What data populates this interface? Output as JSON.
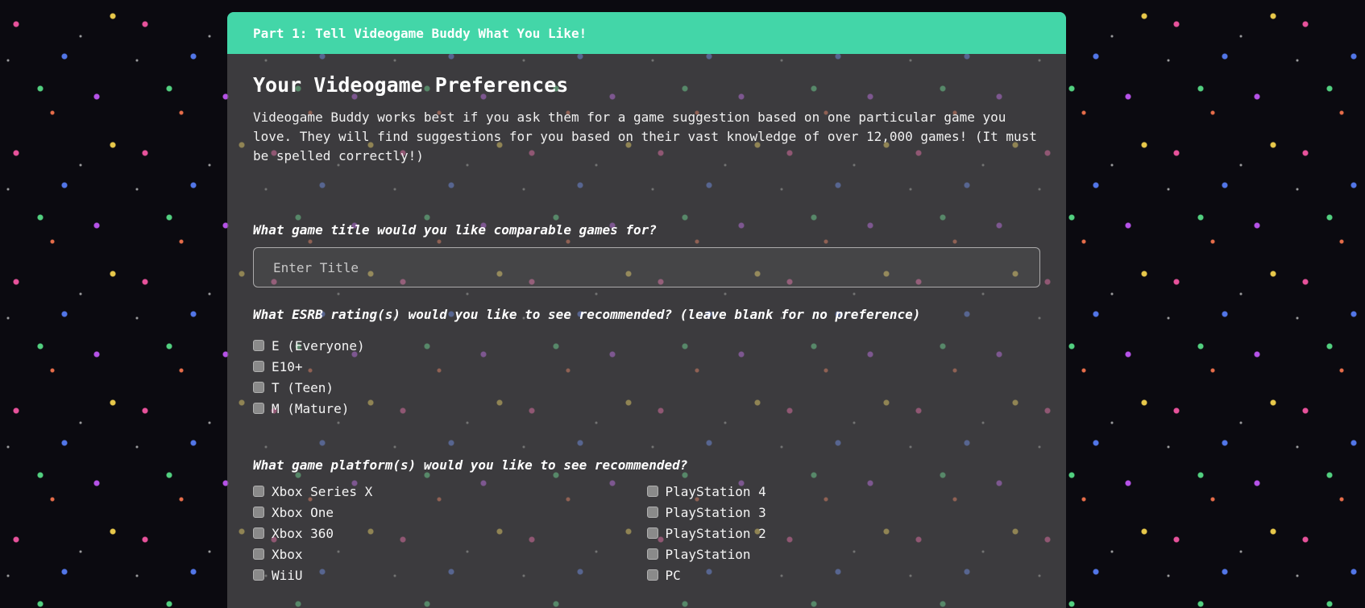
{
  "header": {
    "title": "Part 1: Tell Videogame Buddy What You Like!"
  },
  "preferences": {
    "heading": "Your Videogame Preferences",
    "intro": "Videogame Buddy works best if you ask them for a game suggestion based on one particular game you love. They will find suggestions for you based on their vast knowledge of over 12,000 games! (It must be spelled correctly!)"
  },
  "title_question": {
    "label": "What game title would you like comparable games for?",
    "placeholder": "Enter Title",
    "value": ""
  },
  "esrb": {
    "label": "What ESRB rating(s) would you like to see recommended? (leave blank for no preference)",
    "options": [
      "E (Everyone)",
      "E10+",
      "T (Teen)",
      "M (Mature)"
    ]
  },
  "platforms": {
    "label": "What game platform(s) would you like to see recommended?",
    "left": [
      "Xbox Series X",
      "Xbox One",
      "Xbox 360",
      "Xbox",
      "WiiU"
    ],
    "right": [
      "PlayStation 4",
      "PlayStation 3",
      "PlayStation 2",
      "PlayStation",
      "PC"
    ]
  },
  "colors": {
    "header_bg": "#43d6a8",
    "card_bg": "rgba(90,90,90,0.62)",
    "page_bg": "#0b0a10"
  }
}
